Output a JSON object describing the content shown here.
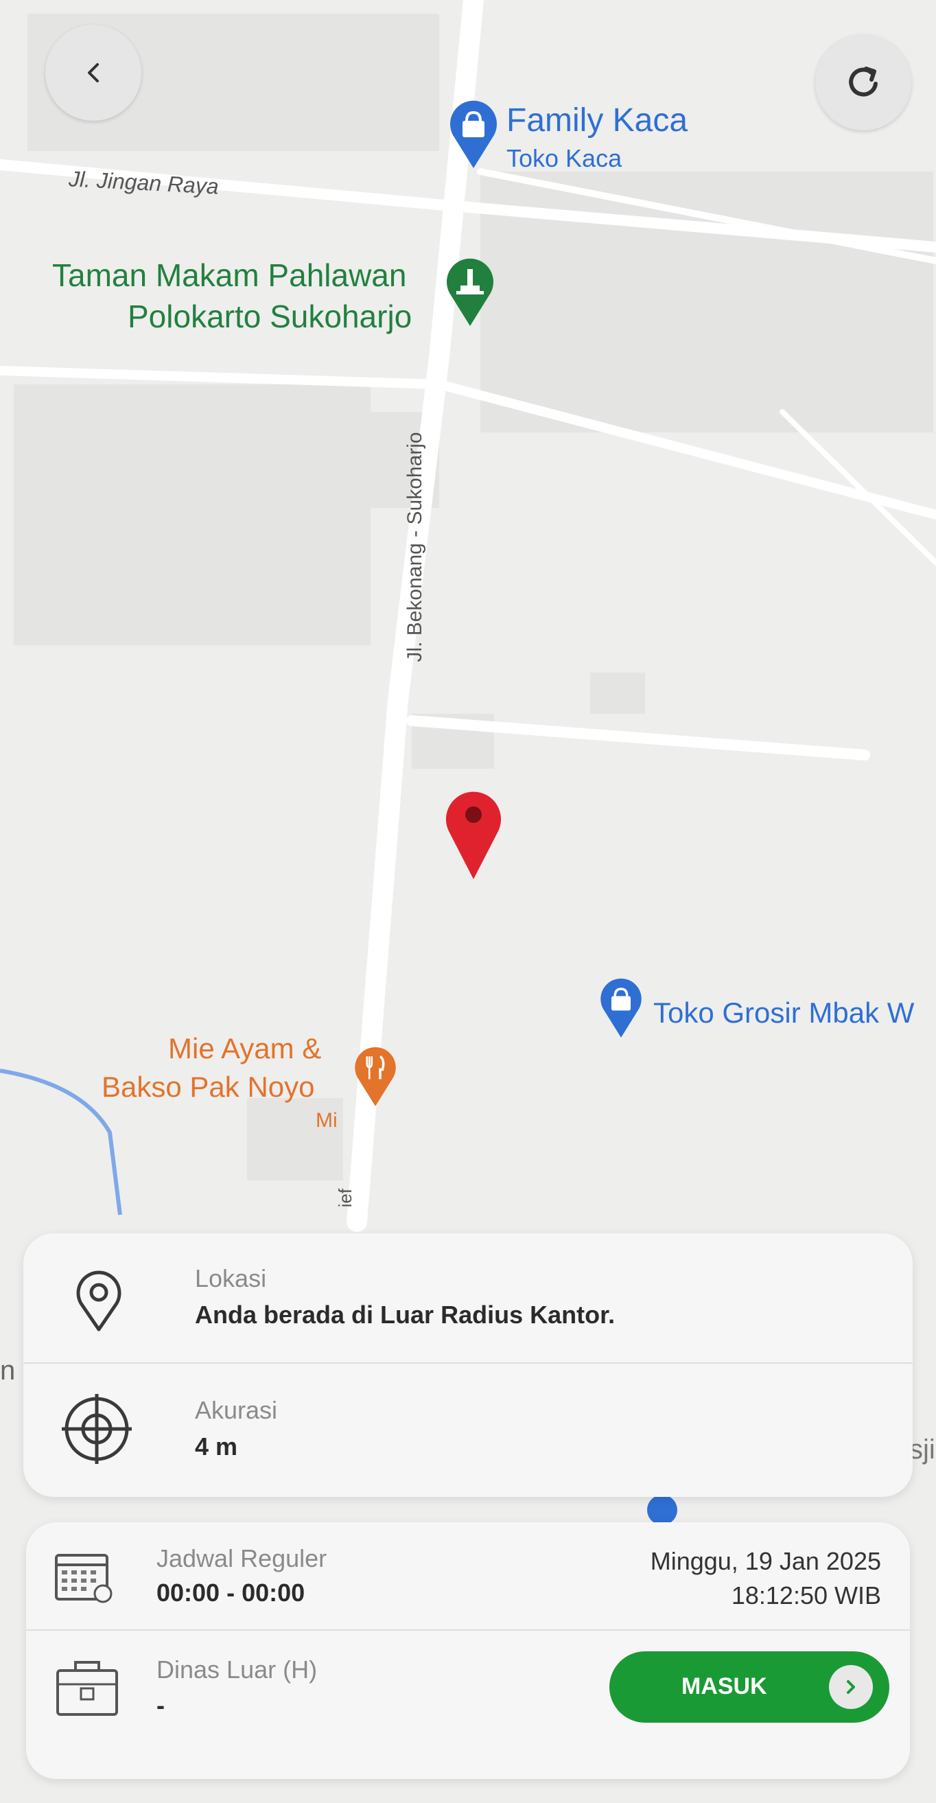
{
  "map": {
    "roads": {
      "jingan": "Jl. Jingan Raya",
      "bekonang": "Jl. Bekonang - Sukoharjo",
      "partial_bottom": "ief",
      "edge_left": "n",
      "edge_right": "sji"
    },
    "pois": {
      "family_kaca": {
        "name": "Family Kaca",
        "category": "Toko Kaca",
        "color": "#2f6fd4",
        "icon": "shopping-bag-icon"
      },
      "taman_makam": {
        "name_line1": "Taman Makam Pahlawan",
        "name_line2": "Polokarto Sukoharjo",
        "color": "#22803f",
        "icon": "monument-icon"
      },
      "toko_grosir": {
        "name": "Toko Grosir Mbak W",
        "color": "#2f6fd4",
        "icon": "shopping-bag-icon"
      },
      "mie_ayam": {
        "name_line1": "Mie Ayam &",
        "name_line2": "Bakso Pak Noyo",
        "category": "Mi",
        "color": "#e2742b",
        "icon": "fork-knife-icon"
      }
    },
    "current_location_pin_color": "#e0222f"
  },
  "controls": {
    "back_icon": "chevron-left-icon",
    "refresh_icon": "refresh-icon"
  },
  "location_card": {
    "location_label": "Lokasi",
    "location_value": "Anda berada di Luar Radius Kantor.",
    "accuracy_label": "Akurasi",
    "accuracy_value": "4 m"
  },
  "schedule_card": {
    "schedule_label": "Jadwal Reguler",
    "schedule_time": "00:00 - 00:00",
    "date": "Minggu, 19 Jan 2025",
    "clock": "18:12:50 WIB",
    "duty_label": "Dinas Luar (H)",
    "duty_value": "-",
    "checkin_button": "MASUK"
  },
  "colors": {
    "accent_green": "#1a9a35",
    "map_bg": "#eeeeed"
  }
}
